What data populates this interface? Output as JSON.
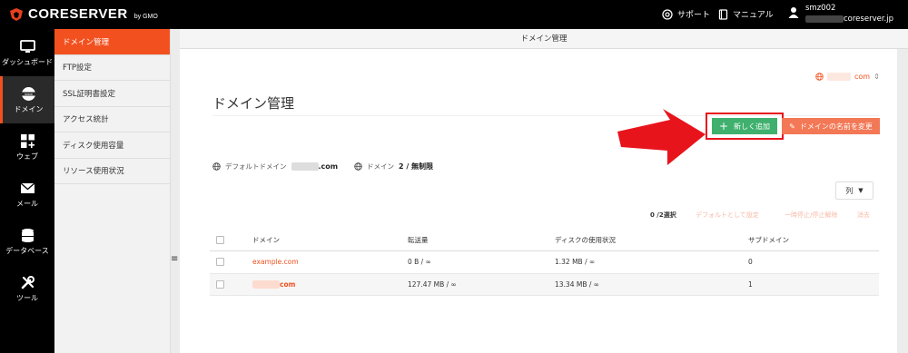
{
  "header": {
    "logo_text": "CORESERVER",
    "logo_sub": "by GMO",
    "support_label": "サポート",
    "manual_label": "マニュアル",
    "user_id": "smz002",
    "user_domain": "coreserver.jp"
  },
  "nav": [
    {
      "label": "ダッシュボード",
      "icon": "monitor-icon",
      "active": false
    },
    {
      "label": "ドメイン",
      "icon": "www-icon",
      "active": true
    },
    {
      "label": "ウェブ",
      "icon": "grid-plus-icon",
      "active": false
    },
    {
      "label": "メール",
      "icon": "envelope-icon",
      "active": false
    },
    {
      "label": "データベース",
      "icon": "database-icon",
      "active": false
    },
    {
      "label": "ツール",
      "icon": "tools-icon",
      "active": false
    }
  ],
  "subnav": [
    {
      "label": "ドメイン管理",
      "active": true
    },
    {
      "label": "FTP設定",
      "active": false
    },
    {
      "label": "SSL証明書設定",
      "active": false
    },
    {
      "label": "アクセス統計",
      "active": false
    },
    {
      "label": "ディスク使用容量",
      "active": false
    },
    {
      "label": "リソース使用状況",
      "active": false
    }
  ],
  "breadcrumb": "ドメイン管理",
  "domain_selector": "com",
  "page_title": "ドメイン管理",
  "buttons": {
    "add": "新しく追加",
    "rename": "ドメインの名前を変更",
    "columns": "列"
  },
  "info": {
    "default_domain_label": "デフォルトドメイン",
    "default_domain_value": ".com",
    "domain_label": "ドメイン",
    "domain_count": "2 / 無制限"
  },
  "bulk": {
    "selected": "0 /2選択",
    "set_default": "デフォルトとして設定",
    "suspend": "一時停止/停止解除",
    "delete": "消去"
  },
  "table": {
    "headers": [
      "ドメイン",
      "転送量",
      "ディスクの使用状況",
      "サブドメイン"
    ],
    "rows": [
      [
        "example.com",
        "0 B / ∞",
        "1.32 MB / ∞",
        "0"
      ],
      [
        "com",
        "127.47 MB / ∞",
        "13.34 MB / ∞",
        "1"
      ]
    ]
  },
  "colors": {
    "accent": "#f2511f",
    "add_button": "#3fb06e",
    "rename_button": "#f37856",
    "highlight": "#e8141c"
  }
}
